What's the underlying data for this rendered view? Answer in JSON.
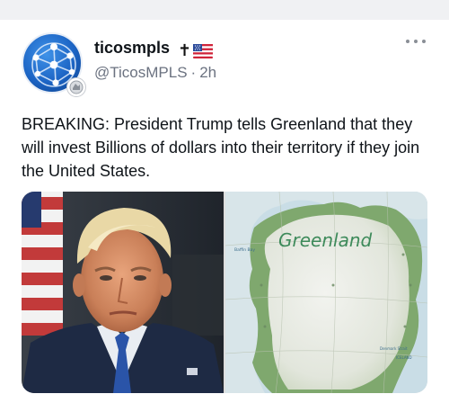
{
  "post": {
    "display_name": "ticosmpls",
    "name_suffix": "✝",
    "handle": "@TicosMPLS",
    "separator": "·",
    "time_ago": "2h",
    "text": "BREAKING: President Trump tells Greenland that they will invest Billions of dollars into their territory if they join the United States.",
    "more_icon": "more-horizontal-icon",
    "media": {
      "map_label": "Greenland"
    }
  },
  "colors": {
    "text_primary": "#0f1419",
    "text_secondary": "#6b7280",
    "top_strip": "#f0f1f3",
    "avatar_blue": "#1c64c4",
    "map_label_green": "#3d8a5a"
  }
}
